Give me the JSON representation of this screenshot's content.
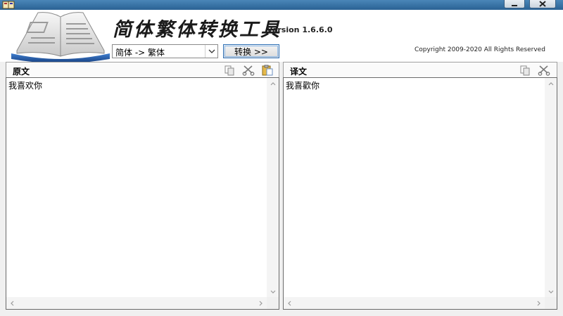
{
  "window": {
    "minimize_icon": "minimize-icon",
    "close_icon": "close-icon"
  },
  "header": {
    "title": "简体繁体转换工具",
    "version": "Version 1.6.6.0",
    "copyright": "Copyright 2009-2020 All Rights Reserved"
  },
  "toolbar": {
    "mode_selected": "简体 -> 繁体",
    "convert_label": "转换 >>"
  },
  "source_panel": {
    "title": "原文",
    "text": "我喜欢你",
    "tools": [
      "copy-icon",
      "cut-icon",
      "paste-icon"
    ]
  },
  "target_panel": {
    "title": "译文",
    "text": "我喜歡你",
    "tools": [
      "copy-icon",
      "cut-icon"
    ]
  },
  "colors": {
    "titlebar": "#2a6294",
    "focus_border": "#2c6fb6"
  }
}
